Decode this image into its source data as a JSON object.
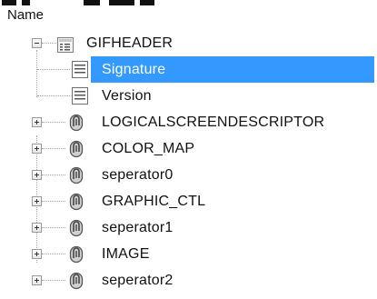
{
  "column_header": "Name",
  "tree": [
    {
      "label": "GIFHEADER",
      "icon": "struct-icon",
      "expander": "collapse"
    },
    {
      "label": "Signature",
      "icon": "document-icon",
      "expander": "none",
      "selected": true
    },
    {
      "label": "Version",
      "icon": "document-icon",
      "expander": "none"
    },
    {
      "label": "LOGICALSCREENDESCRIPTOR",
      "icon": "paperclip-icon",
      "expander": "expand"
    },
    {
      "label": "COLOR_MAP",
      "icon": "paperclip-icon",
      "expander": "expand"
    },
    {
      "label": "seperator0",
      "icon": "paperclip-icon",
      "expander": "expand"
    },
    {
      "label": "GRAPHIC_CTL",
      "icon": "paperclip-icon",
      "expander": "expand"
    },
    {
      "label": "seperator1",
      "icon": "paperclip-icon",
      "expander": "expand"
    },
    {
      "label": "IMAGE",
      "icon": "paperclip-icon",
      "expander": "expand"
    },
    {
      "label": "seperator2",
      "icon": "paperclip-icon",
      "expander": "expand"
    }
  ],
  "colors": {
    "selection": "#3399ff",
    "selection_text": "#ffffff",
    "text": "#111111",
    "tree_lines": "#a0a0a0"
  }
}
